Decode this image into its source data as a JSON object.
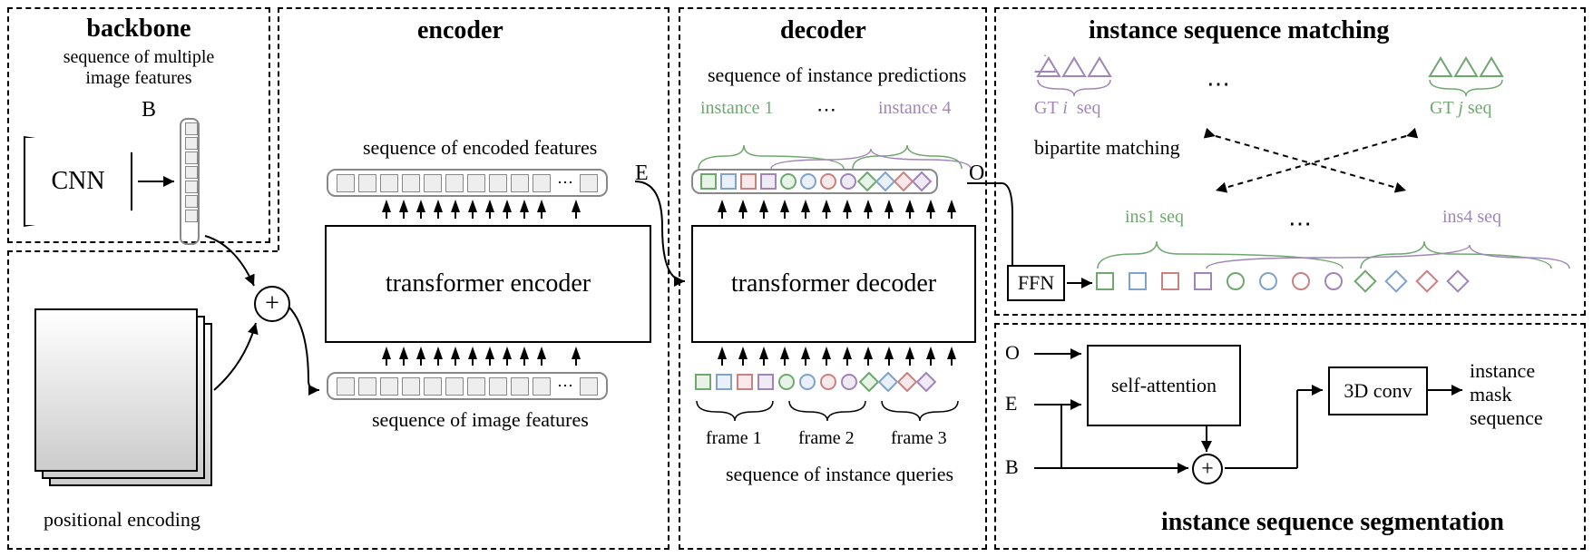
{
  "backbone": {
    "title": "backbone",
    "subtitle": "sequence of multiple\nimage features",
    "cnn": "CNN",
    "b": "B",
    "pos_enc": "positional encoding"
  },
  "encoder": {
    "title": "encoder",
    "top_label": "sequence of encoded features",
    "block": "transformer encoder",
    "bottom_label": "sequence of image features",
    "e": "E"
  },
  "decoder": {
    "title": "decoder",
    "top_label": "sequence of instance predictions",
    "inst1": "instance 1",
    "inst4": "instance 4",
    "block": "transformer decoder",
    "frame1": "frame 1",
    "frame2": "frame 2",
    "frame3": "frame 3",
    "bottom_label": "sequence of instance queries",
    "o": "O"
  },
  "matching": {
    "title": "instance sequence matching",
    "gt_i": "GT",
    "gt_i_suffix": "seq",
    "gt_i_var": "i",
    "gt_j": "GT",
    "gt_j_suffix": "seq",
    "gt_j_var": "j",
    "bip": "bipartite matching",
    "ffn": "FFN",
    "ins1": "ins1 seq",
    "ins4": "ins4 seq"
  },
  "segmentation": {
    "title": "instance sequence segmentation",
    "o": "O",
    "e": "E",
    "b": "B",
    "sa": "self-attention",
    "conv": "3D conv",
    "out": "instance\nmask\nsequence"
  },
  "colors": {
    "green": "#8fc98f",
    "blue": "#a3c2e6",
    "red": "#d99494",
    "purple": "#c2a3d6"
  }
}
